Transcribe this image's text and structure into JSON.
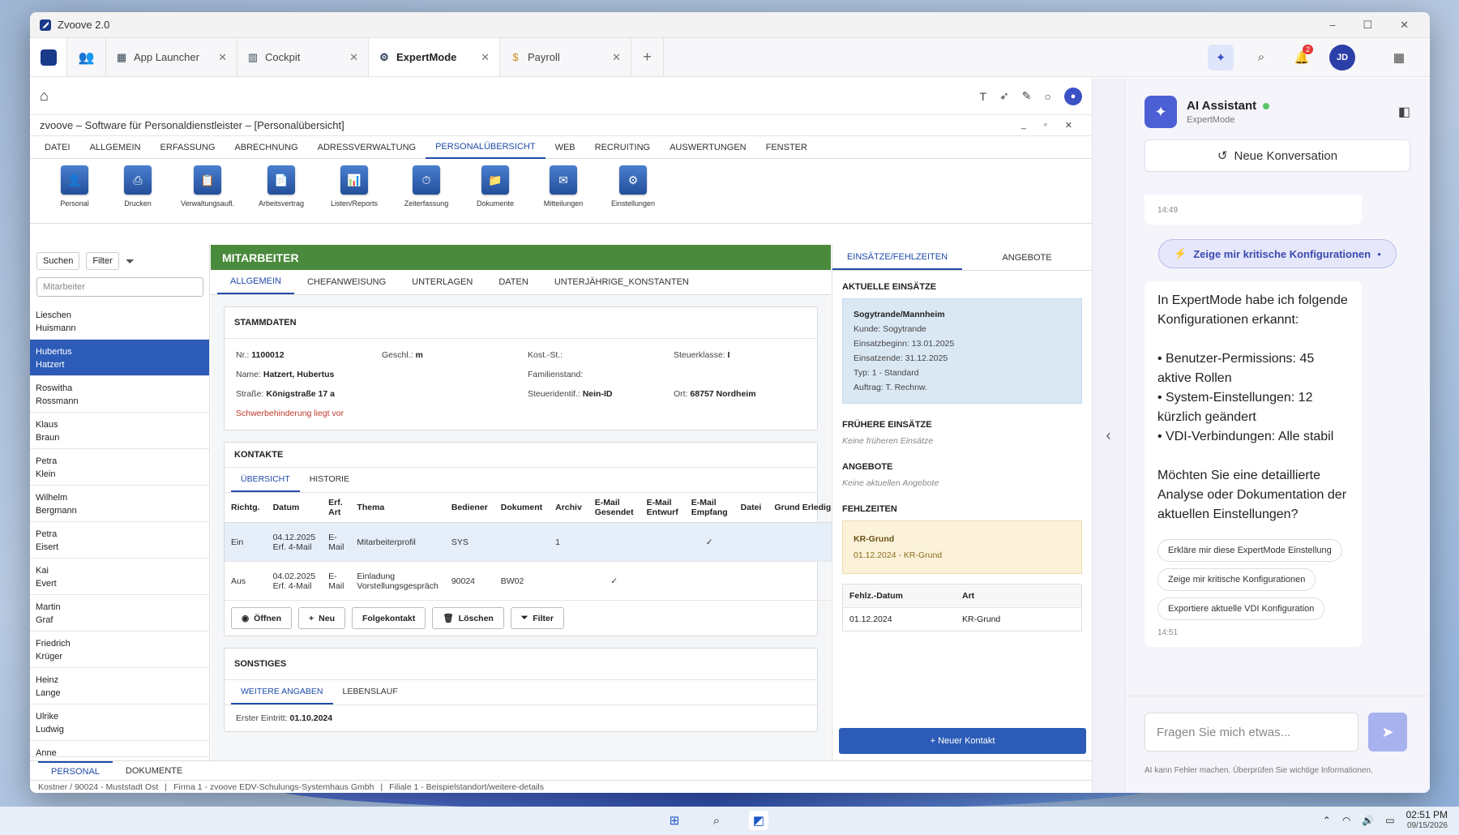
{
  "window": {
    "title": "Zvoove 2.0"
  },
  "tabs": [
    {
      "label": "App Launcher",
      "icon": "grid-icon"
    },
    {
      "label": "Cockpit",
      "icon": "chart-icon"
    },
    {
      "label": "ExpertMode",
      "icon": "gear-icon"
    },
    {
      "label": "Payroll",
      "icon": "dollar-icon"
    }
  ],
  "notifications_count": "2",
  "user_initials": "JD",
  "app": {
    "title": "zvoove – Software für Personaldienstleister – [Personalübersicht]",
    "menu": [
      "DATEI",
      "ALLGEMEIN",
      "ERFASSUNG",
      "ABRECHNUNG",
      "ADRESSVERWALTUNG",
      "PERSONALÜBERSICHT",
      "WEB",
      "RECRUITING",
      "AUSWERTUNGEN",
      "FENSTER"
    ],
    "ribbon": [
      "Personal",
      "Drucken",
      "Verwaltungsaufl.",
      "Arbeitsvertrag",
      "Listen/Reports",
      "Zeiterfassung",
      "Dokumente",
      "Mitteilungen",
      "Einstellungen"
    ]
  },
  "left": {
    "search_label": "Suchen",
    "filter_label": "Filter",
    "placeholder": "Mitarbeiter",
    "employees": [
      [
        "Lieschen",
        "Huismann"
      ],
      [
        "Hubertus",
        "Hatzert"
      ],
      [
        "Roswitha",
        "Rossmann"
      ],
      [
        "Klaus",
        "Braun"
      ],
      [
        "Petra",
        "Klein"
      ],
      [
        "Wilhelm",
        "Bergmann"
      ],
      [
        "Petra",
        "Eisert"
      ],
      [
        "Kai",
        "Evert"
      ],
      [
        "Martin",
        "Graf"
      ],
      [
        "Friedrich",
        "Krüger"
      ],
      [
        "Heinz",
        "Lange"
      ],
      [
        "Ulrike",
        "Ludwig"
      ],
      [
        "Anne",
        ""
      ]
    ]
  },
  "center": {
    "header": "MITARBEITER",
    "subtabs": [
      "ALLGEMEIN",
      "CHEFANWEISUNG",
      "UNTERLAGEN",
      "DATEN",
      "UNTERJÄHRIGE_KONSTANTEN"
    ],
    "stammdaten": {
      "title": "STAMMDATEN",
      "nr_label": "Nr.:",
      "nr": "1100012",
      "geschl_label": "Geschl.:",
      "geschl": "m",
      "kost_label": "Kost.-St.:",
      "steuerklasse_label": "Steuerklasse:",
      "steuerklasse": "I",
      "name_label": "Name:",
      "name": "Hatzert, Hubertus",
      "familienstand_label": "Familienstand:",
      "strasse_label": "Straße:",
      "strasse": "Königstraße 17 a",
      "steuerid_label": "Steueridentif.:",
      "steuerid": "Nein-ID",
      "ort_label": "Ort:",
      "ort": "68757 Nordheim",
      "warning": "Schwerbehinderung liegt vor"
    },
    "kontakte": {
      "title": "KONTAKTE",
      "tabs": [
        "ÜBERSICHT",
        "HISTORIE"
      ],
      "columns": [
        "Richtg.",
        "Datum",
        "Erf. Art",
        "Thema",
        "Bediener",
        "Dokument",
        "Archiv",
        "E-Mail Gesendet",
        "E-Mail Entwurf",
        "E-Mail Empfang",
        "Datei",
        "Grund Erledig"
      ],
      "rows": [
        {
          "richtg": "Ein",
          "datum": "04.12.2025 Erf. 4-Mail",
          "art": "E-Mail",
          "thema": "Mitarbeiterprofil",
          "bediener": "SYS",
          "dokument": "",
          "archiv": "1",
          "ges": "",
          "ent": "",
          "emp": "✓"
        },
        {
          "richtg": "Aus",
          "datum": "04.02.2025 Erf. 4-Mail",
          "art": "E-Mail",
          "thema": "Einladung Vorstellungsgespräch",
          "bediener": "90024",
          "dokument": "BW02",
          "archiv": "",
          "ges": "✓",
          "ent": "",
          "emp": ""
        }
      ],
      "buttons": [
        "Öffnen",
        "Neu",
        "Folgekontakt",
        "Löschen",
        "Filter"
      ]
    },
    "sonstiges": {
      "title": "SONSTIGES",
      "tabs": [
        "WEITERE ANGABEN",
        "LEBENSLAUF"
      ],
      "eintritt_label": "Erster Eintritt:",
      "eintritt": "01.10.2024"
    }
  },
  "right": {
    "tabs": [
      "EINSÄTZE/FEHLZEITEN",
      "ANGEBOTE"
    ],
    "aktuelle_title": "AKTUELLE EINSÄTZE",
    "einsatz": {
      "name": "Sogytrande/Mannheim",
      "kunde": "Kunde: Sogytrande",
      "beginn": "Einsatzbeginn: 13.01.2025",
      "ende": "Einsatzende: 31.12.2025",
      "typ": "Typ: 1 - Standard",
      "auftrag": "Auftrag: T. Rechnw."
    },
    "fruehere_title": "FRÜHERE EINSÄTZE",
    "fruehere_empty": "Keine früheren Einsätze",
    "angebote_title": "ANGEBOTE",
    "angebote_empty": "Keine aktuellen Angebote",
    "fehlzeiten_title": "FEHLZEITEN",
    "fehl": {
      "name": "KR-Grund",
      "detail": "01.12.2024 - KR-Grund"
    },
    "fehl_table": {
      "h1": "Fehlz.-Datum",
      "h2": "Art",
      "v1": "01.12.2024",
      "v2": "KR-Grund"
    },
    "new_contact": "+ Neuer Kontakt"
  },
  "bottom": {
    "tabs": [
      "PERSONAL",
      "DOKUMENTE"
    ],
    "status": [
      "Kostner / 90024 - Muststadt Ost",
      "|",
      "Firma 1 - zvoove EDV-Schulungs-Systemhaus Gmbh",
      "|",
      "Filiale 1 - Beispielstandort/weitere-details"
    ]
  },
  "ai": {
    "title": "AI Assistant",
    "subtitle": "ExpertMode",
    "new_conversation": "Neue Konversation",
    "ts1": "14:49",
    "user_msg": "Zeige mir kritische Konfigurationen",
    "reply": "In ExpertMode habe ich folgende Konfigurationen erkannt:\n\n• Benutzer-Permissions: 45 aktive Rollen\n• System-Einstellungen: 12 kürzlich geändert\n• VDI-Verbindungen: Alle stabil\n\nMöchten Sie eine detaillierte Analyse oder Dokumentation der aktuellen Einstellungen?",
    "chips": [
      "Erkläre mir diese ExpertMode Einstellung",
      "Zeige mir kritische Konfigurationen",
      "Exportiere aktuelle VDI Konfiguration"
    ],
    "ts2": "14:51",
    "placeholder": "Fragen Sie mich etwas...",
    "disclaimer": "AI kann Fehler machen. Überprüfen Sie wichtige Informationen."
  },
  "taskbar": {
    "time": "02:51 PM",
    "date": "09/15/2026"
  }
}
